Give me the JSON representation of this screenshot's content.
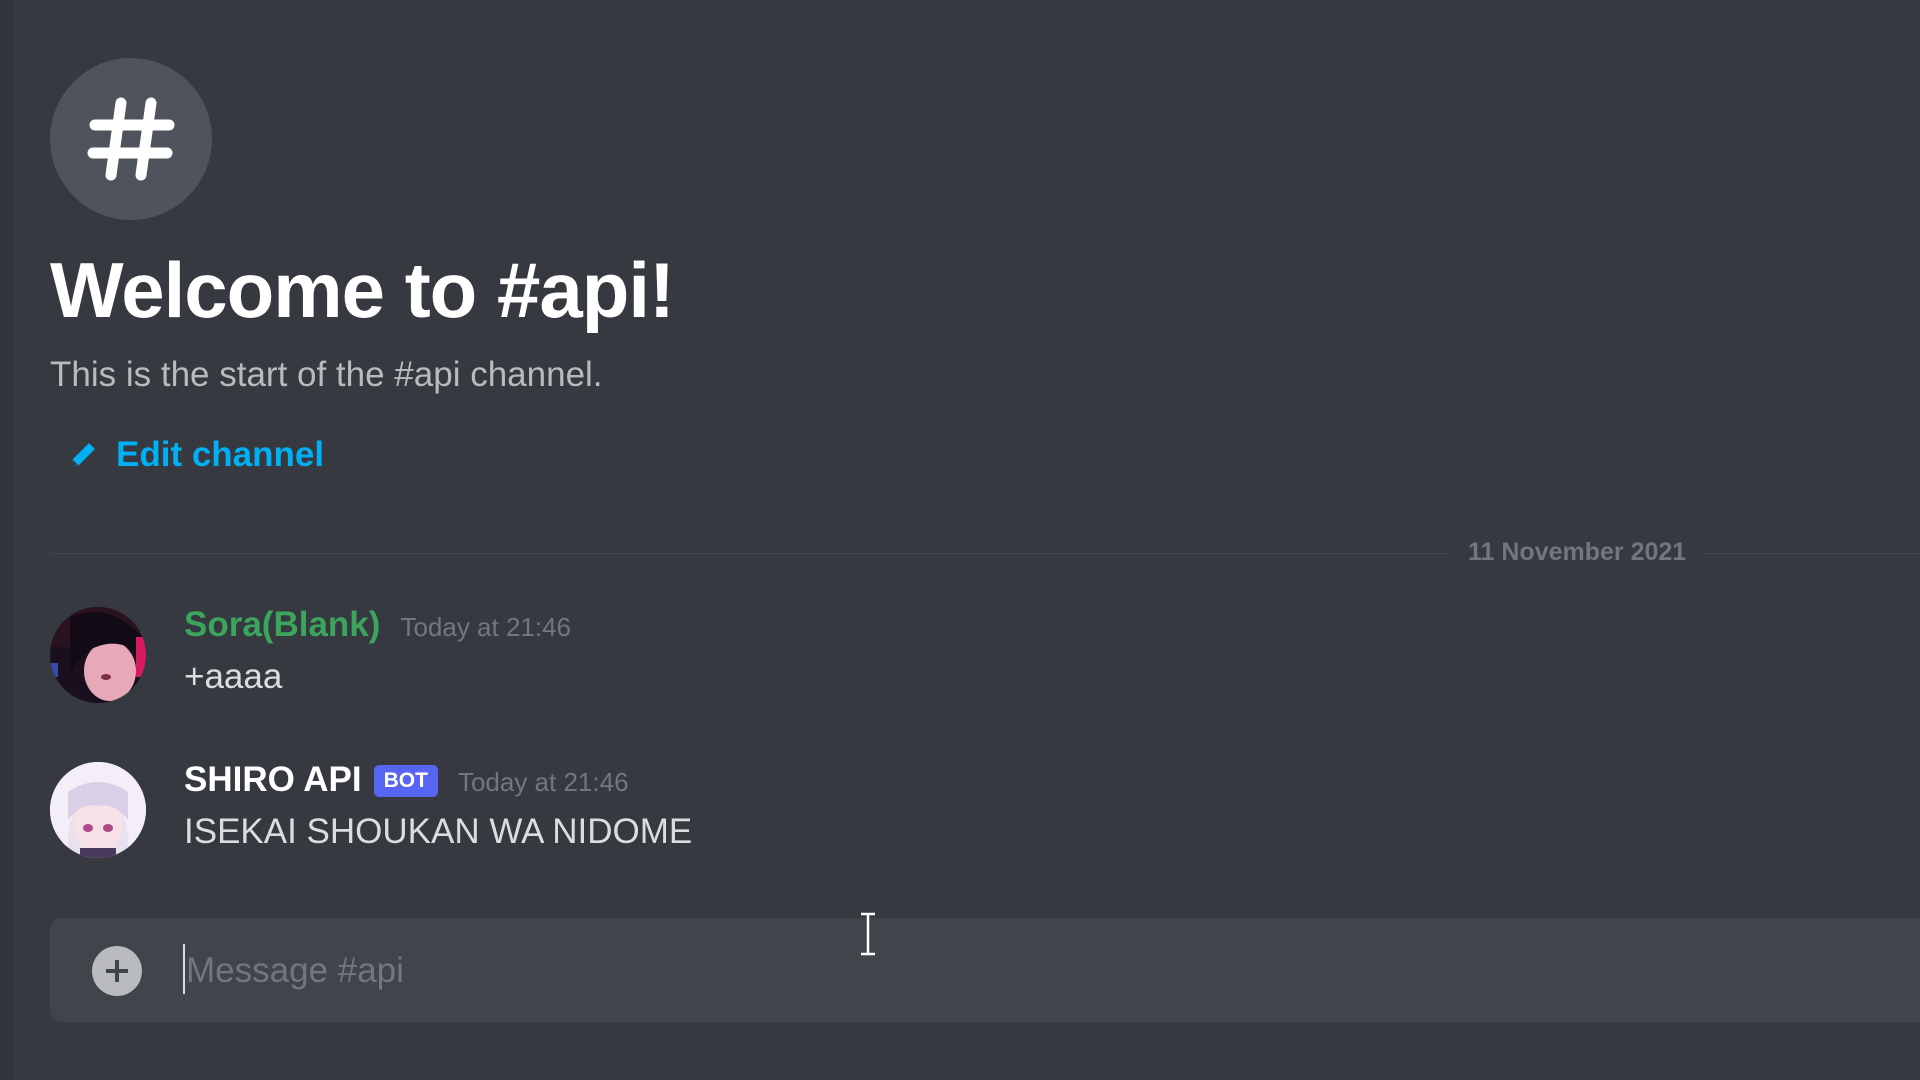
{
  "welcome": {
    "icon": "hashtag-icon",
    "title": "Welcome to #api!",
    "subtitle": "This is the start of the #api channel.",
    "edit_icon": "pencil-icon",
    "edit_label": "Edit channel",
    "accent": "#00b0f4"
  },
  "divider": {
    "date": "11 November 2021"
  },
  "messages": [
    {
      "avatar": "avatar-sora",
      "username": "Sora(Blank)",
      "username_color": "#3ba55d",
      "timestamp": "Today at 21:46",
      "content": "+aaaa"
    },
    {
      "avatar": "avatar-shiro",
      "username": "SHIRO API",
      "bot_tag": "BOT",
      "username_color": "#ffffff",
      "timestamp": "Today at 21:46",
      "content": "ISEKAI SHOUKAN WA NIDOME"
    }
  ],
  "composer": {
    "attach_icon": "plus-circle-icon",
    "placeholder": "Message #api",
    "value": ""
  },
  "colors": {
    "background": "#36393f",
    "bot_tag": "#5865f2",
    "composer": "#40444b"
  }
}
